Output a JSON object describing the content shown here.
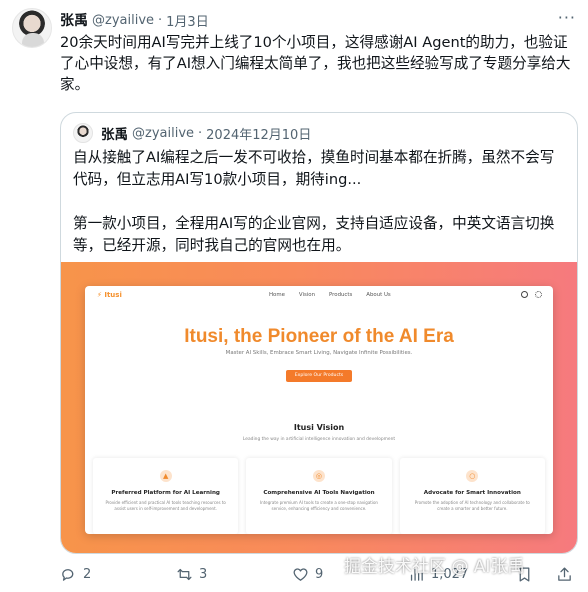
{
  "tweet": {
    "author_name": "张禹",
    "author_handle": "@zyailive",
    "separator": "·",
    "date": "1月3日",
    "text": "20余天时间用AI写完并上线了10个小项目，这得感谢AI Agent的助力，也验证了心中设想，有了AI想入门编程太简单了，我也把这些经验写成了专题分享给大家。"
  },
  "quote": {
    "author_name": "张禹",
    "author_handle": "@zyailive",
    "separator": "·",
    "date": "2024年12月10日",
    "paragraph1": "自从接触了AI编程之后一发不可收拾，摸鱼时间基本都在折腾，虽然不会写代码，但立志用AI写10款小项目，期待ing...",
    "paragraph2": "第一款小项目，全程用AI写的企业官网，支持自适应设备，中英文语言切换等，已经开源，同时我自己的官网也在用。"
  },
  "preview": {
    "logo": "⚡ Itusi",
    "nav": [
      "Home",
      "Vision",
      "Products",
      "About Us"
    ],
    "hero_title": "Itusi, the Pioneer of the AI Era",
    "hero_subtitle": "Master AI Skills, Embrace Smart Living, Navigate Infinite Possibilities.",
    "cta": "Explore Our Products",
    "section_title": "Itusi Vision",
    "section_subtitle": "Leading the way in artificial intelligence innovation and development",
    "cards": [
      {
        "icon": "graduation-cap-icon",
        "title": "Preferred Platform for AI Learning",
        "desc": "Provide efficient and practical AI tools teaching resources to assist users in self-improvement and development."
      },
      {
        "icon": "compass-icon",
        "title": "Comprehensive AI Tools Navigation",
        "desc": "Integrate premium AI tools to create a one-stop navigation service, enhancing efficiency and convenience."
      },
      {
        "icon": "lightbulb-icon",
        "title": "Advocate for Smart Innovation",
        "desc": "Promote the adoption of AI technology and collaborate to create a smarter and better future."
      }
    ]
  },
  "actions": {
    "replies": "2",
    "retweets": "3",
    "likes": "9",
    "views": "1,027"
  },
  "watermark": "掘金技术社区 @ AI张禹",
  "colors": {
    "text": "#0f1419",
    "muted": "#536471",
    "border": "#cfd9de",
    "accent": "#f08a2c"
  }
}
